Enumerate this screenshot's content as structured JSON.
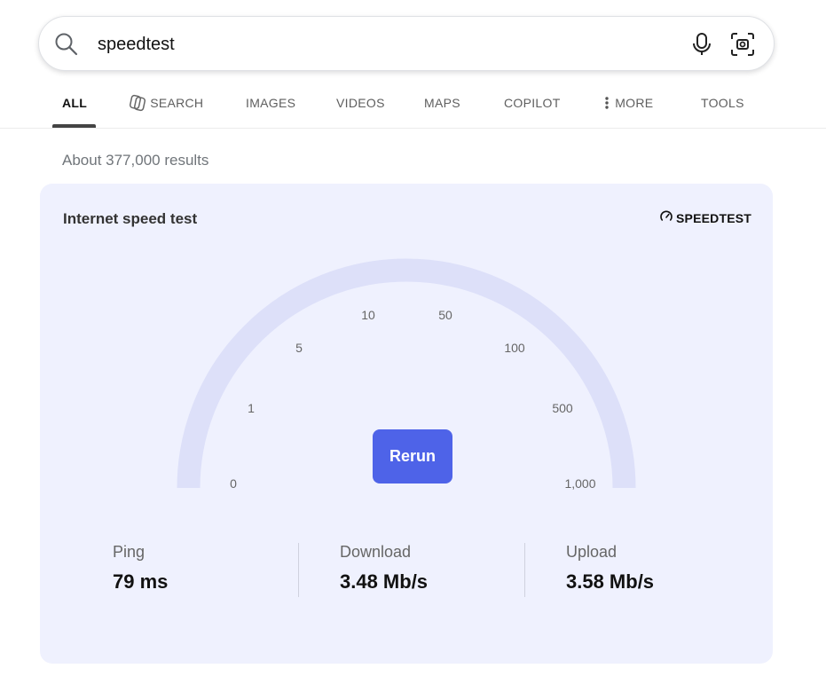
{
  "search": {
    "query": "speedtest"
  },
  "tabs": [
    {
      "label": "ALL",
      "active": true
    },
    {
      "label": "SEARCH",
      "icon": "copilot-icon"
    },
    {
      "label": "IMAGES"
    },
    {
      "label": "VIDEOS"
    },
    {
      "label": "MAPS"
    },
    {
      "label": "COPILOT"
    },
    {
      "label": "MORE",
      "icon": "more-vertical-icon"
    },
    {
      "label": "TOOLS"
    }
  ],
  "results_count": "About 377,000 results",
  "speed_card": {
    "title": "Internet speed test",
    "brand": "SPEEDTEST",
    "brand_icon": "gauge-icon",
    "gauge_ticks": [
      "0",
      "1",
      "5",
      "10",
      "50",
      "100",
      "500",
      "1,000"
    ],
    "gauge_color": "#dde0f9",
    "rerun_label": "Rerun",
    "stats": [
      {
        "label": "Ping",
        "value": "79 ms"
      },
      {
        "label": "Download",
        "value": "3.48 Mb/s"
      },
      {
        "label": "Upload",
        "value": "3.58 Mb/s"
      }
    ]
  },
  "colors": {
    "card_background": "#eff1fe",
    "accent": "#4e63e8"
  }
}
